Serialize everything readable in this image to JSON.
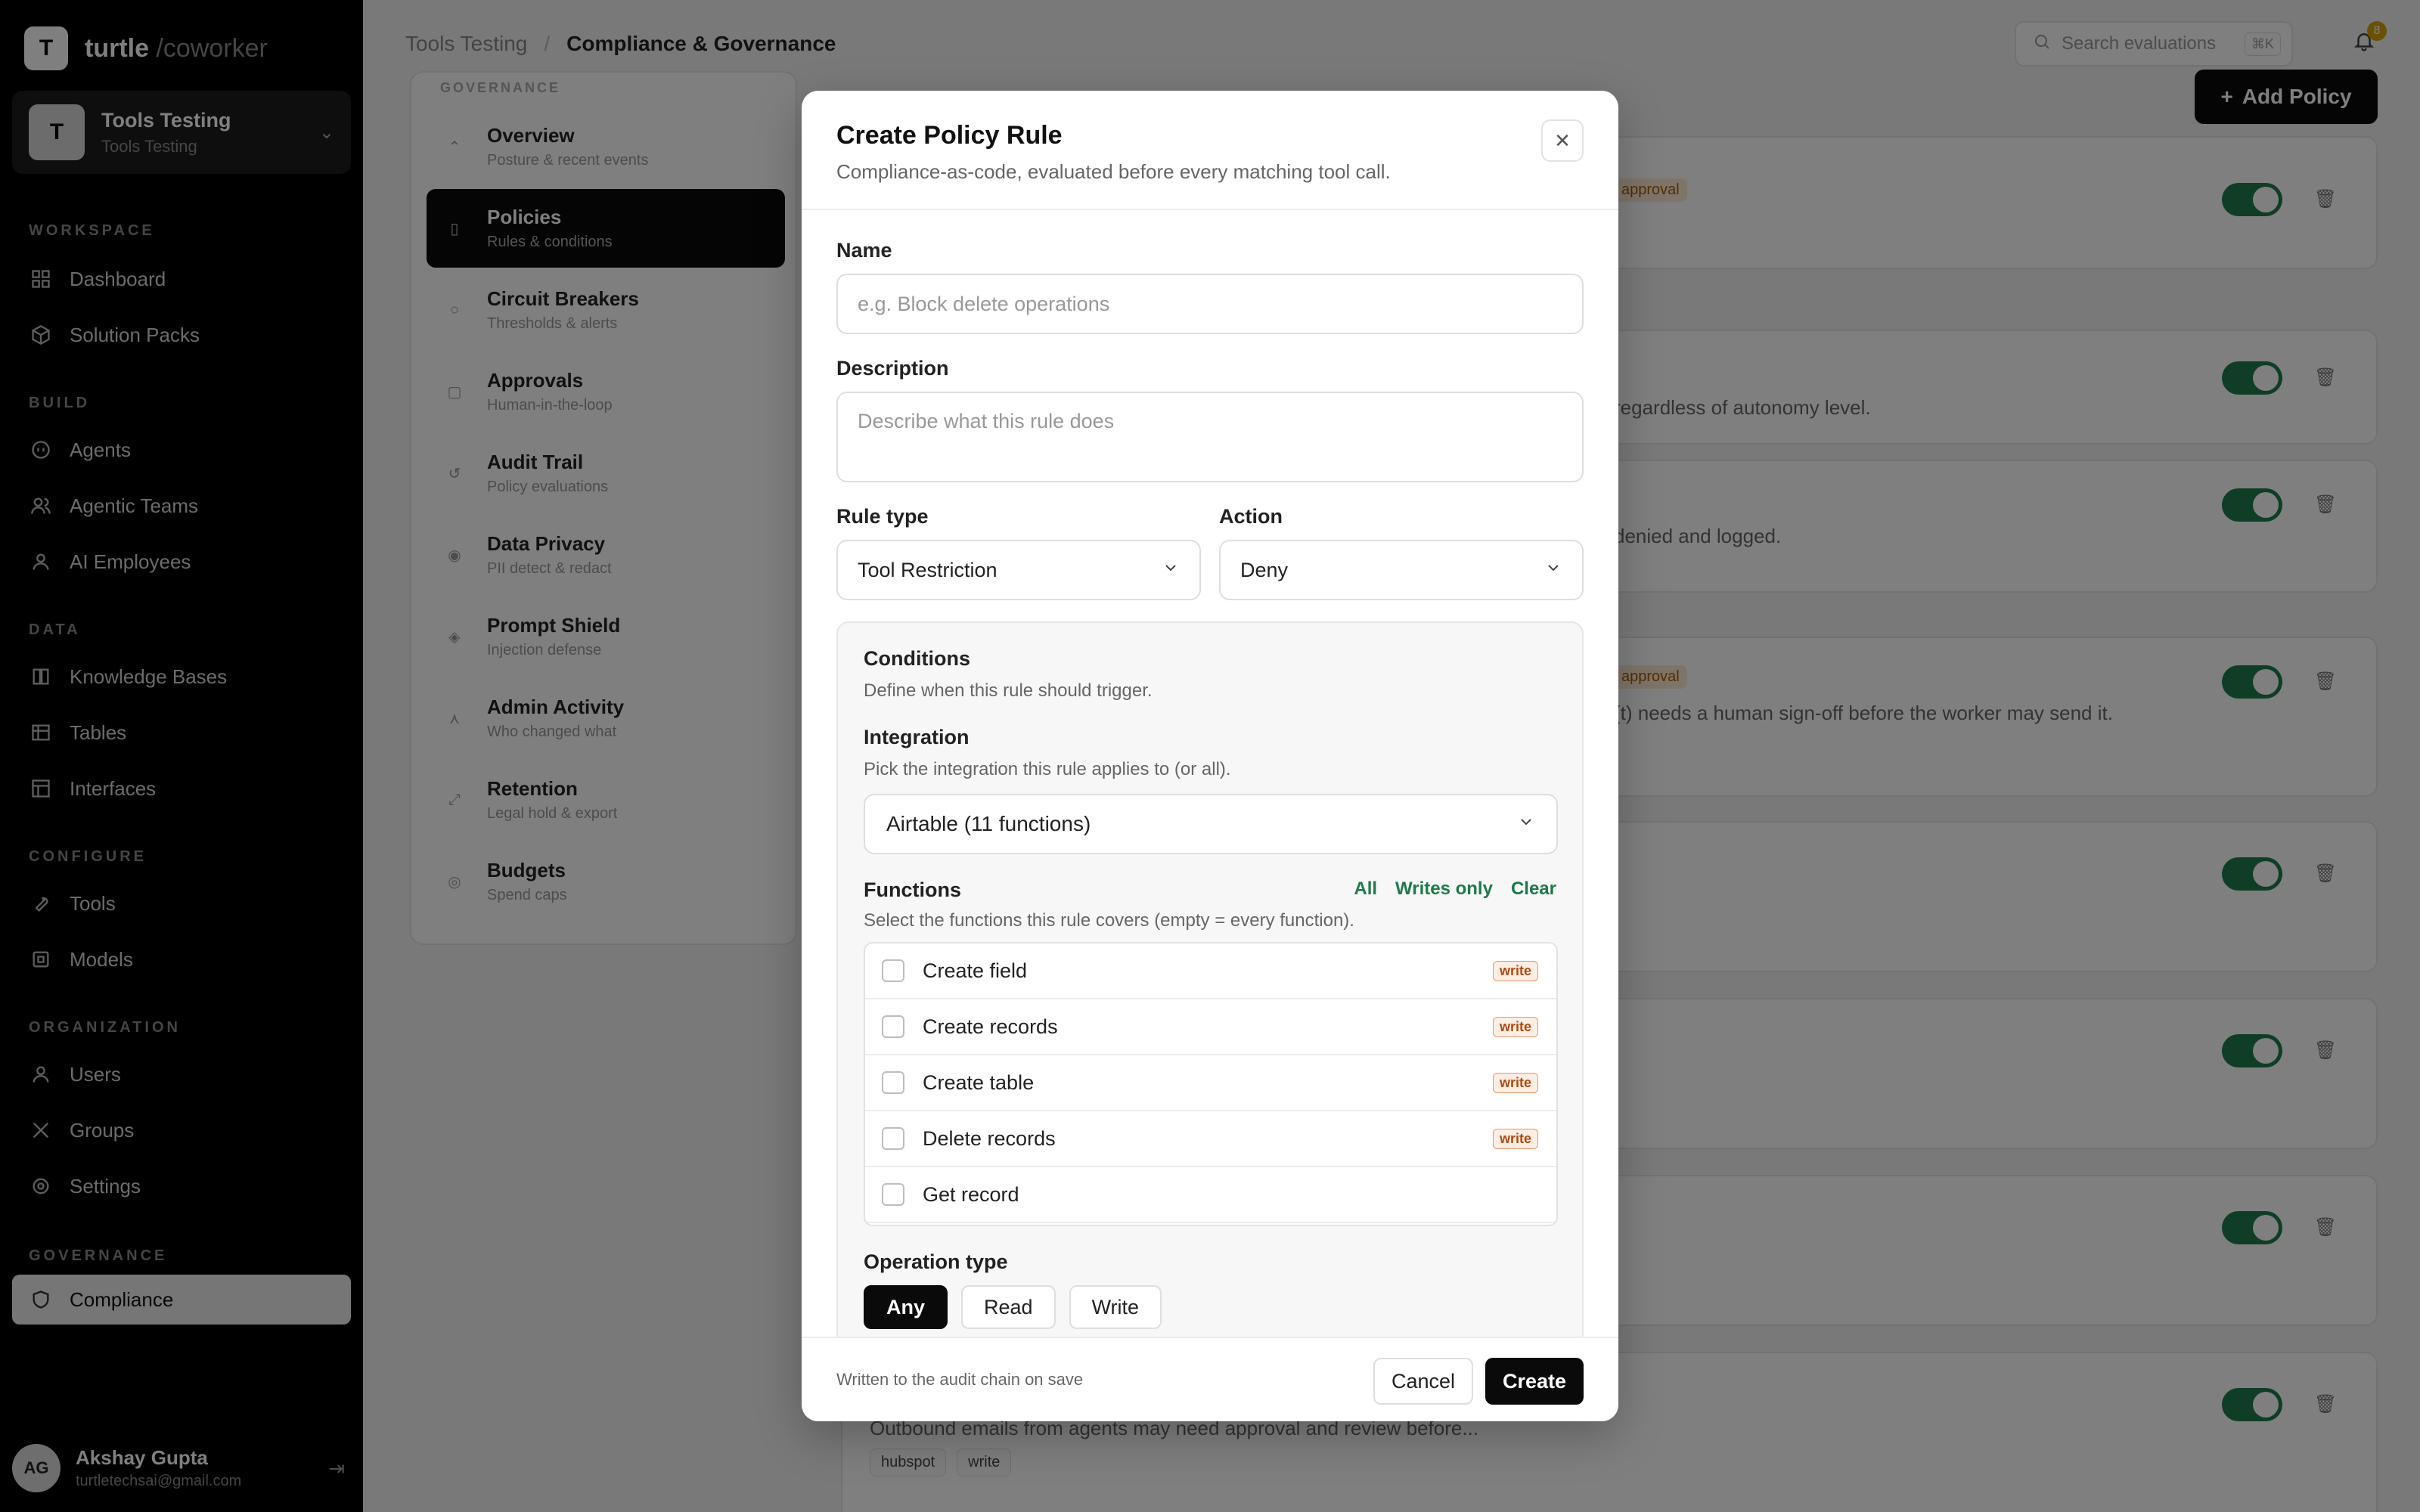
{
  "brand": {
    "logo_letter": "T",
    "name": "turtle",
    "suffix": "/coworker"
  },
  "workspace": {
    "initial": "T",
    "title": "Tools Testing",
    "subtitle": "Tools Testing"
  },
  "sidebar": {
    "sections": [
      {
        "label": "WORKSPACE",
        "items": [
          {
            "label": "Dashboard",
            "icon": "dashboard-icon"
          },
          {
            "label": "Solution Packs",
            "icon": "package-icon"
          }
        ]
      },
      {
        "label": "BUILD",
        "items": [
          {
            "label": "Agents",
            "icon": "bot-icon"
          },
          {
            "label": "Agentic Teams",
            "icon": "team-icon"
          },
          {
            "label": "AI Employees",
            "icon": "user-icon"
          }
        ]
      },
      {
        "label": "DATA",
        "items": [
          {
            "label": "Knowledge Bases",
            "icon": "book-icon"
          },
          {
            "label": "Tables",
            "icon": "table-icon"
          },
          {
            "label": "Interfaces",
            "icon": "layout-icon"
          }
        ]
      },
      {
        "label": "CONFIGURE",
        "items": [
          {
            "label": "Tools",
            "icon": "wrench-icon"
          },
          {
            "label": "Models",
            "icon": "model-icon"
          }
        ]
      },
      {
        "label": "ORGANIZATION",
        "items": [
          {
            "label": "Users",
            "icon": "user-icon"
          },
          {
            "label": "Groups",
            "icon": "groups-icon"
          },
          {
            "label": "Settings",
            "icon": "gear-icon"
          }
        ]
      },
      {
        "label": "GOVERNANCE",
        "items": [
          {
            "label": "Compliance",
            "icon": "shield-icon",
            "active": true
          }
        ]
      }
    ]
  },
  "user": {
    "initials": "AG",
    "name": "Akshay Gupta",
    "email": "turtletechsai@gmail.com"
  },
  "topbar": {
    "crumb1": "Tools Testing",
    "sep": "/",
    "crumb2": "Compliance & Governance",
    "search_placeholder": "Search evaluations",
    "search_kbd": "⌘K",
    "notif_count": "8"
  },
  "subnav": {
    "heading": "GOVERNANCE",
    "items": [
      {
        "title": "Overview",
        "sub": "Posture & recent events"
      },
      {
        "title": "Policies",
        "sub": "Rules & conditions",
        "active": true
      },
      {
        "title": "Circuit Breakers",
        "sub": "Thresholds & alerts"
      },
      {
        "title": "Approvals",
        "sub": "Human-in-the-loop"
      },
      {
        "title": "Audit Trail",
        "sub": "Policy evaluations"
      },
      {
        "title": "Data Privacy",
        "sub": "PII detect & redact"
      },
      {
        "title": "Prompt Shield",
        "sub": "Injection defense"
      },
      {
        "title": "Admin Activity",
        "sub": "Who changed what"
      },
      {
        "title": "Retention",
        "sub": "Legal hold & export"
      },
      {
        "title": "Budgets",
        "sub": "Spend caps"
      }
    ]
  },
  "add_policy_label": "Add Policy",
  "policy_cards": {
    "pill_label": "approval",
    "desc2": "regardless of autonomy level.",
    "desc3": "denied and logged.",
    "desc4": "(t) needs a human sign-off before the worker may send it.",
    "desc_last": "Outbound emails from agents may need approval and review before...",
    "chip1": "hubspot",
    "chip2": "write"
  },
  "modal": {
    "title": "Create Policy Rule",
    "subtitle": "Compliance-as-code, evaluated before every matching tool call.",
    "close_icon": "close-icon",
    "name_label": "Name",
    "name_placeholder": "e.g. Block delete operations",
    "desc_label": "Description",
    "desc_placeholder": "Describe what this rule does",
    "rule_type_label": "Rule type",
    "rule_type_value": "Tool Restriction",
    "action_label": "Action",
    "action_value": "Deny",
    "conditions": {
      "title": "Conditions",
      "subtitle": "Define when this rule should trigger.",
      "integration_label": "Integration",
      "integration_sub": "Pick the integration this rule applies to (or all).",
      "integration_value": "Airtable (11 functions)",
      "functions_label": "Functions",
      "link_all": "All",
      "link_writes": "Writes only",
      "link_clear": "Clear",
      "functions_sub": "Select the functions this rule covers (empty = every function).",
      "functions": [
        {
          "name": "Create field",
          "badge": "write"
        },
        {
          "name": "Create records",
          "badge": "write"
        },
        {
          "name": "Create table",
          "badge": "write"
        },
        {
          "name": "Delete records",
          "badge": "write"
        },
        {
          "name": "Get record",
          "badge": ""
        }
      ],
      "operation_label": "Operation type",
      "operations": [
        "Any",
        "Read",
        "Write"
      ],
      "operation_selected": "Any"
    },
    "footer_note": "Written to the audit chain on save",
    "cancel_label": "Cancel",
    "create_label": "Create"
  },
  "colors": {
    "accent_green": "#1f7a4a",
    "write_badge": "#b24a12",
    "dark": "#0a0a0a"
  }
}
